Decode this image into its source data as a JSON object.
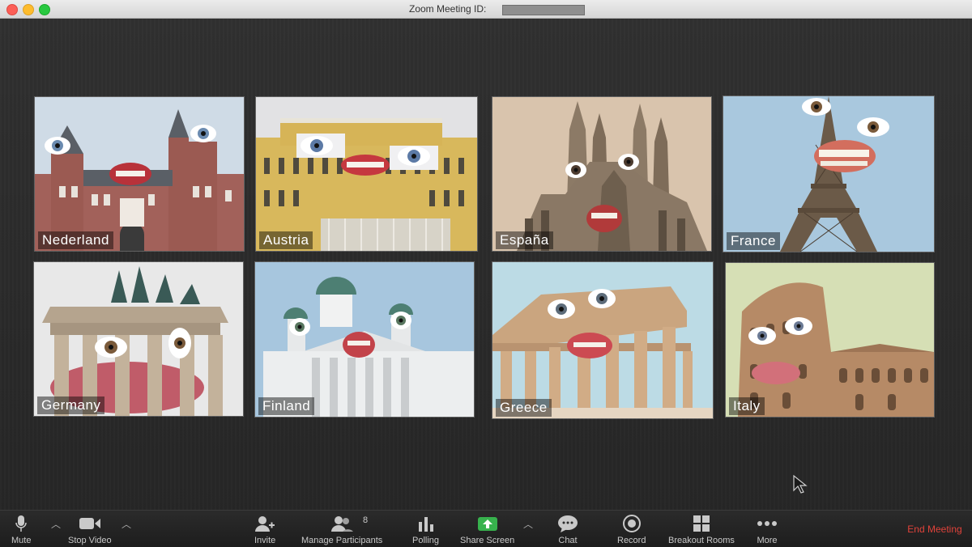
{
  "window": {
    "title": "Zoom Meeting ID:"
  },
  "participants": [
    {
      "name": "Nederland",
      "sky": "#cfdbe6"
    },
    {
      "name": "Austria",
      "sky": "#e2e2e4"
    },
    {
      "name": "España",
      "sky": "#d9c4ad"
    },
    {
      "name": "France",
      "sky": "#a9c8de"
    },
    {
      "name": "Germany",
      "sky": "#e8e8e8"
    },
    {
      "name": "Finland",
      "sky": "#a7c6de"
    },
    {
      "name": "Greece",
      "sky": "#bcdbe5"
    },
    {
      "name": "Italy",
      "sky": "#d6dfb5"
    }
  ],
  "toolbar": {
    "mute_label": "Mute",
    "stop_video_label": "Stop Video",
    "invite_label": "Invite",
    "manage_participants_label": "Manage Participants",
    "participant_count": "8",
    "polling_label": "Polling",
    "share_screen_label": "Share Screen",
    "chat_label": "Chat",
    "record_label": "Record",
    "breakout_rooms_label": "Breakout Rooms",
    "more_label": "More",
    "end_meeting_label": "End Meeting"
  },
  "colors": {
    "share_green": "#37b24d",
    "end_red": "#e0423a"
  }
}
